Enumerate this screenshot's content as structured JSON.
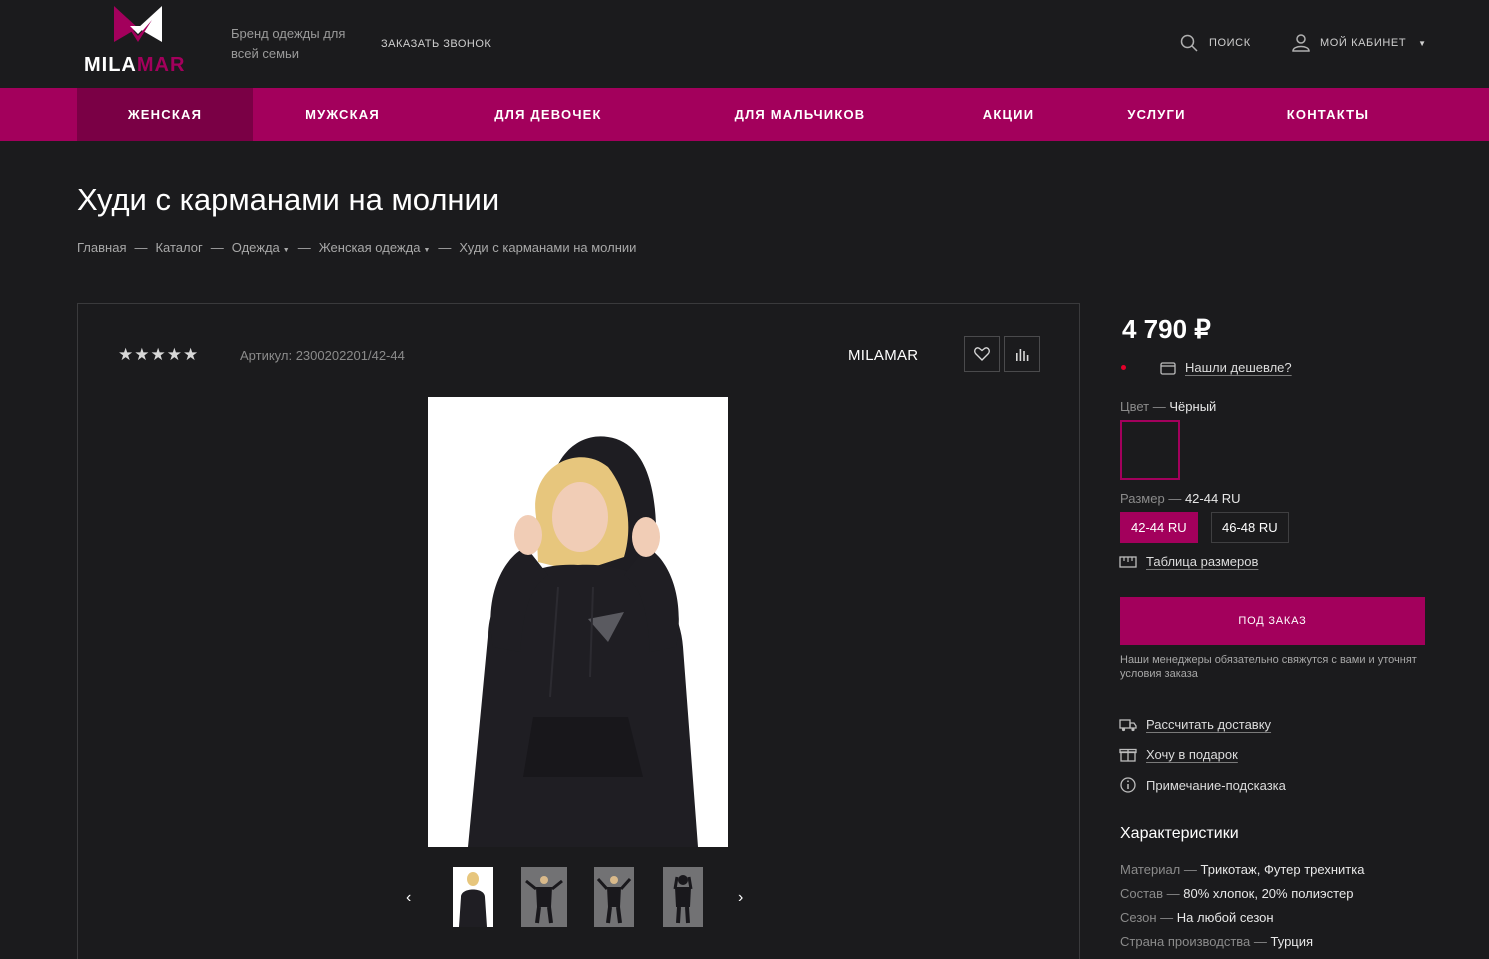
{
  "header": {
    "logo_text_a": "MILA",
    "logo_text_b": "MAR",
    "tagline": "Бренд одежды для всей семьи",
    "callback": "ЗАКАЗАТЬ ЗВОНОК",
    "search": "ПОИСК",
    "account": "МОЙ КАБИНЕТ"
  },
  "nav": {
    "items": [
      "ЖЕНСКАЯ",
      "МУЖСКАЯ",
      "ДЛЯ ДЕВОЧЕК",
      "ДЛЯ МАЛЬЧИКОВ",
      "АКЦИИ",
      "УСЛУГИ",
      "КОНТАКТЫ"
    ],
    "active": "ЖЕНСКАЯ"
  },
  "page": {
    "title": "Худи с карманами на молнии"
  },
  "breadcrumb": {
    "items": [
      "Главная",
      "Каталог",
      "Одежда",
      "Женская одежда",
      "Худи с карманами на молнии"
    ],
    "sep": "—"
  },
  "product": {
    "stars": "★★★★★",
    "rating": 5,
    "article": "Артикул: 2300202201/42-44",
    "brand": "MILAMAR"
  },
  "buy": {
    "price": "4 790 ₽",
    "cheaper": "Нашли дешевле?",
    "color_label": "Цвет",
    "color_value": "Чёрный",
    "size_label": "Размер",
    "size_value": "42-44 RU",
    "sizes": [
      "42-44 RU",
      "46-48 RU"
    ],
    "size_table": "Таблица размеров",
    "order_button": "ПОД ЗАКАЗ",
    "order_note": "Наши менеджеры обязательно свяжутся с вами и уточнят условия заказа",
    "delivery": "Рассчитать доставку",
    "gift": "Хочу в подарок",
    "hint": "Примечание-подсказка"
  },
  "characteristics": {
    "title": "Характеристики",
    "items": [
      {
        "label": "Материал",
        "value": "Трикотаж, Футер трехнитка"
      },
      {
        "label": "Состав",
        "value": "80% хлопок, 20% полиэстер"
      },
      {
        "label": "Сезон",
        "value": "На любой сезон"
      },
      {
        "label": "Страна производства",
        "value": "Турция"
      }
    ]
  },
  "colors": {
    "accent": "#a3005c",
    "accent_dark": "#7a0045",
    "background": "#1b1b1d"
  }
}
